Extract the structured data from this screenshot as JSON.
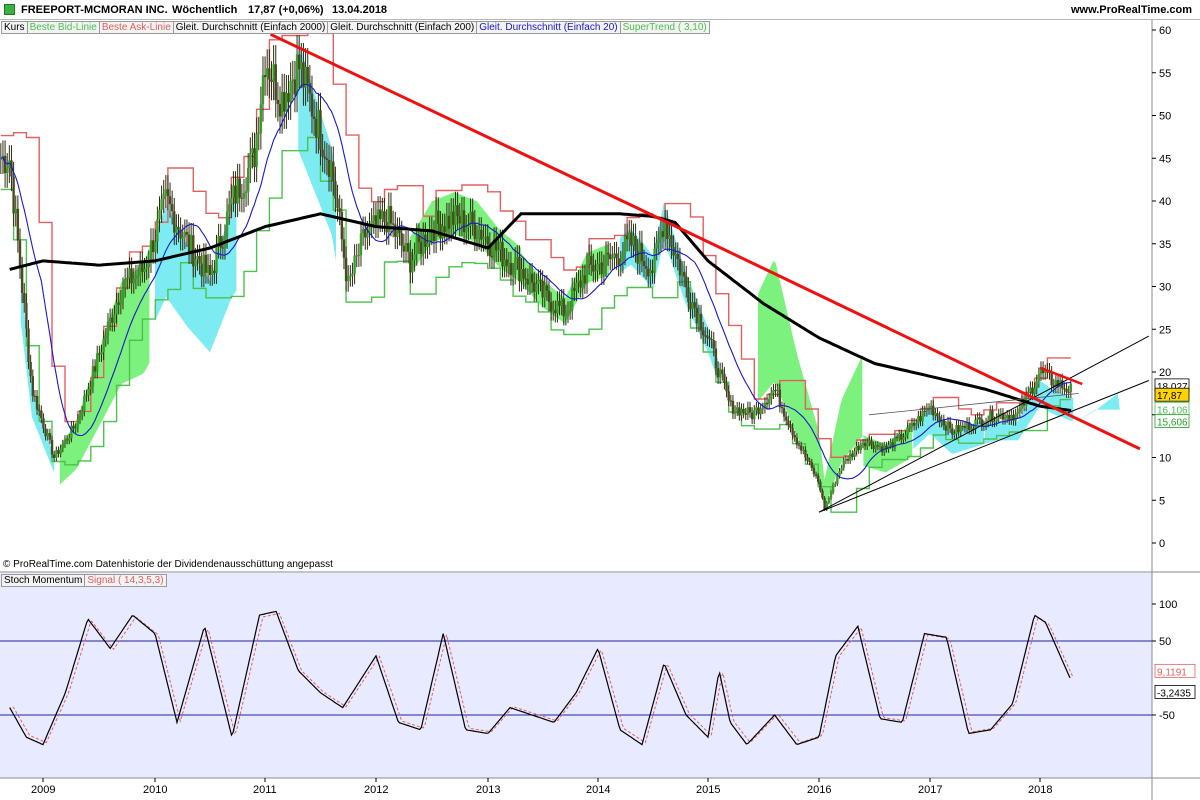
{
  "header": {
    "title": "FREEPORT-MCMORAN INC.",
    "period": "Wöchentlich",
    "price": "17,87 (+0,06%)",
    "date": "13.04.2018",
    "site": "www.ProRealTime.com"
  },
  "legend": {
    "items": [
      {
        "label": "Kurs",
        "color": "#000000"
      },
      {
        "label": "Beste Bid-Linie",
        "color": "#4cc24c"
      },
      {
        "label": "Beste Ask-Linie",
        "color": "#e06060"
      },
      {
        "label": "Gleit. Durchschnitt (Einfach 2000)",
        "color": "#000000"
      },
      {
        "label": "Gleit. Durchschnitt (Einfach 200)",
        "color": "#000000"
      },
      {
        "label": "Gleit. Durchschnitt (Einfach 20)",
        "color": "#1a1ac8"
      },
      {
        "label": "SuperTrend ( 3,10)",
        "color": "#4cc24c"
      }
    ]
  },
  "footnote": "© ProRealTime.com Datenhistorie der Dividendenausschüttung angepasst",
  "stoch_legend": {
    "items": [
      {
        "label": "Stoch Momentum",
        "color": "#000000"
      },
      {
        "label": "Signal ( 14,3,5,3)",
        "color": "#e06060"
      }
    ]
  },
  "price_badges": {
    "upper": "18,027",
    "current": "17,87",
    "lower1": "16,106",
    "lower2": "15,606"
  },
  "stoch_badges": {
    "signal": "9,1191",
    "momentum": "-3,2435"
  },
  "colors": {
    "price_bg": "#ffffff",
    "stoch_bg": "#e8ebff",
    "candle_up": "#3a9d2a",
    "candle_down": "#4a4a20",
    "ask": "#e06060",
    "bid": "#4cc24c",
    "cloud_green": "#66ee66",
    "cloud_cyan": "#66e8f0",
    "sma200": "#000000",
    "sma20": "#1a1ac8",
    "trendline": "#ee1111",
    "channel": "#000000",
    "current_badge": "#ffd400"
  },
  "chart_data": [
    {
      "type": "line",
      "title": "FREEPORT-MCMORAN INC.",
      "period": "weekly",
      "y_axis": {
        "ticks": [
          "60",
          "55",
          "50",
          "45",
          "40",
          "35",
          "30",
          "25",
          "20",
          "15",
          "10",
          "5",
          "0"
        ],
        "range": [
          -1,
          60.5
        ]
      },
      "x_axis": {
        "ticks": [
          "2009",
          "2010",
          "2011",
          "2012",
          "2013",
          "2014",
          "2015",
          "2016",
          "2017",
          "2018"
        ]
      },
      "series": [
        {
          "name": "Kurs",
          "x": [
            2008.7,
            2008.9,
            2009.1,
            2009.3,
            2009.5,
            2009.7,
            2009.9,
            2010.1,
            2010.3,
            2010.5,
            2010.7,
            2010.9,
            2011.0,
            2011.15,
            2011.3,
            2011.45,
            2011.6,
            2011.75,
            2011.9,
            2012.1,
            2012.3,
            2012.5,
            2012.7,
            2012.9,
            2013.1,
            2013.3,
            2013.5,
            2013.7,
            2013.9,
            2014.1,
            2014.3,
            2014.5,
            2014.6,
            2014.8,
            2015.0,
            2015.2,
            2015.4,
            2015.6,
            2015.8,
            2016.0,
            2016.05,
            2016.2,
            2016.4,
            2016.6,
            2016.8,
            2017.0,
            2017.2,
            2017.4,
            2017.6,
            2017.8,
            2018.0,
            2018.1,
            2018.28
          ],
          "y": [
            45,
            18,
            10,
            14,
            22,
            30,
            32,
            40,
            35,
            31,
            40,
            45,
            57,
            52,
            56,
            50,
            44,
            30,
            36,
            38,
            33,
            37,
            38,
            37,
            34,
            32,
            29,
            27,
            32,
            33,
            35,
            32,
            38,
            30,
            24,
            16,
            15,
            18,
            12,
            7,
            4,
            9,
            12,
            11,
            13,
            16,
            13,
            14,
            15,
            15,
            20,
            19,
            17.87
          ]
        },
        {
          "name": "Gleit. Durchschnitt (Einfach 200)",
          "x": [
            2008.7,
            2009.0,
            2009.5,
            2010.0,
            2010.5,
            2011.0,
            2011.5,
            2012.0,
            2012.5,
            2013.0,
            2013.3,
            2013.8,
            2014.2,
            2014.5,
            2014.7,
            2015.0,
            2015.5,
            2016.0,
            2016.5,
            2017.0,
            2017.5,
            2018.0,
            2018.28
          ],
          "y": [
            32,
            33,
            32.5,
            33,
            34.5,
            37,
            38.5,
            37,
            36.5,
            34.5,
            38.5,
            38.5,
            38.5,
            38.2,
            37.5,
            33,
            28,
            24,
            21,
            19.5,
            18,
            16,
            15.5
          ]
        },
        {
          "name": "Trendline (red)",
          "x": [
            2011.05,
            2014.55,
            2018.9
          ],
          "y": [
            59.5,
            38.0,
            11.0
          ]
        }
      ]
    },
    {
      "type": "line",
      "title": "Stoch Momentum",
      "y_axis": {
        "ticks": [
          "100",
          "50",
          "-50"
        ],
        "range": [
          -100,
          110
        ]
      },
      "series": [
        {
          "name": "Stoch Momentum",
          "x": [
            2008.7,
            2008.85,
            2009.0,
            2009.2,
            2009.4,
            2009.6,
            2009.8,
            2010.0,
            2010.2,
            2010.45,
            2010.7,
            2010.95,
            2011.1,
            2011.3,
            2011.5,
            2011.7,
            2012.0,
            2012.2,
            2012.4,
            2012.6,
            2012.8,
            2013.0,
            2013.2,
            2013.4,
            2013.6,
            2013.8,
            2014.0,
            2014.2,
            2014.4,
            2014.6,
            2014.8,
            2015.0,
            2015.1,
            2015.2,
            2015.35,
            2015.6,
            2015.8,
            2016.0,
            2016.15,
            2016.35,
            2016.55,
            2016.75,
            2016.95,
            2017.15,
            2017.35,
            2017.55,
            2017.75,
            2017.95,
            2018.05,
            2018.28
          ],
          "y": [
            -40,
            -80,
            -90,
            -20,
            80,
            40,
            85,
            60,
            -60,
            70,
            -80,
            85,
            90,
            10,
            -20,
            -40,
            30,
            -60,
            -70,
            60,
            -70,
            -75,
            -40,
            -50,
            -60,
            -20,
            40,
            -70,
            -90,
            20,
            -50,
            -80,
            10,
            -60,
            -90,
            -50,
            -90,
            -80,
            30,
            70,
            -55,
            -60,
            60,
            55,
            -75,
            -70,
            -35,
            85,
            75,
            -3.24
          ]
        }
      ]
    }
  ]
}
